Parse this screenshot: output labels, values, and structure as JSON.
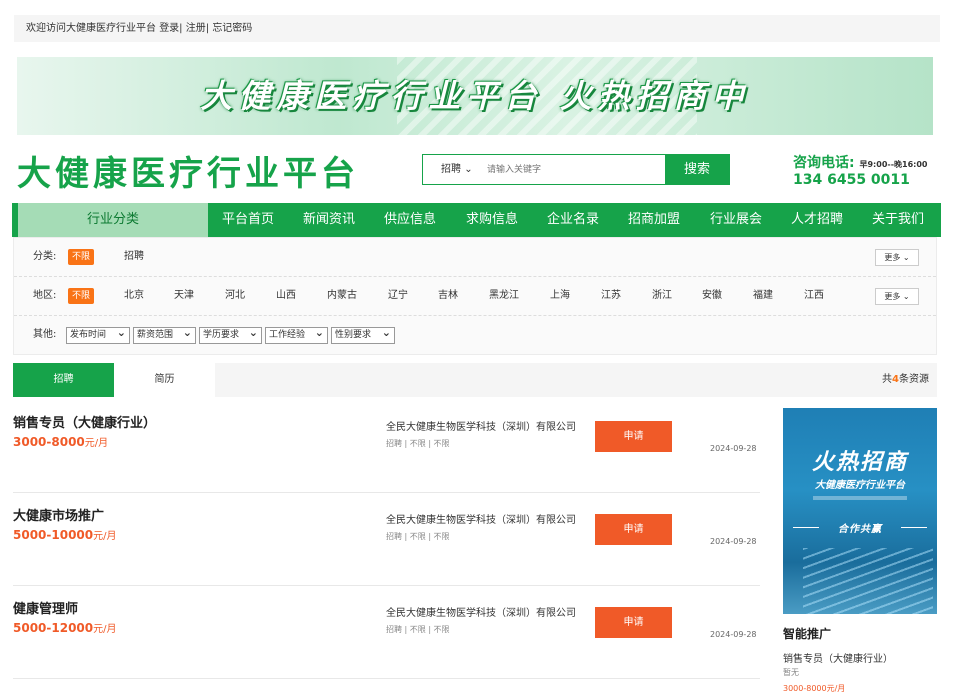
{
  "topbar": {
    "welcome": "欢迎访问大健康医疗行业平台",
    "login": "登录|",
    "register": "注册|",
    "forgot": "忘记密码"
  },
  "banner": {
    "text": "大健康医疗行业平台  火热招商中"
  },
  "logo": {
    "text": "大健康医疗行业平台"
  },
  "search": {
    "category": "招聘",
    "placeholder": "请输入关键字",
    "button": "搜索"
  },
  "contact": {
    "label": "咨询电话:",
    "hours": "早9:00--晚16:00",
    "phone": "134 6455 0011"
  },
  "nav": {
    "category": "行业分类",
    "items": [
      "平台首页",
      "新闻资讯",
      "供应信息",
      "求购信息",
      "企业名录",
      "招商加盟",
      "行业展会",
      "人才招聘",
      "关于我们"
    ]
  },
  "filters": {
    "type_label": "分类:",
    "type_selected": "不限",
    "type_options": [
      "招聘"
    ],
    "region_label": "地区:",
    "region_selected": "不限",
    "regions": [
      "北京",
      "天津",
      "河北",
      "山西",
      "内蒙古",
      "辽宁",
      "吉林",
      "黑龙江",
      "上海",
      "江苏",
      "浙江",
      "安徽",
      "福建",
      "江西"
    ],
    "more": "更多",
    "other_label": "其他:",
    "selects": [
      "发布时间",
      "薪资范围",
      "学历要求",
      "工作经验",
      "性别要求"
    ]
  },
  "tabs": {
    "active": "招聘",
    "inactive": "简历",
    "count_prefix": "共",
    "count": "4",
    "count_suffix": "条资源"
  },
  "jobs": [
    {
      "title": "销售专员（大健康行业）",
      "salary": "3000-8000",
      "unit": "元/月",
      "company": "全民大健康生物医学科技（深圳）有限公司",
      "meta": "招聘 | 不限 | 不限",
      "apply": "申请",
      "date": "2024-09-28"
    },
    {
      "title": "大健康市场推广",
      "salary": "5000-10000",
      "unit": "元/月",
      "company": "全民大健康生物医学科技（深圳）有限公司",
      "meta": "招聘 | 不限 | 不限",
      "apply": "申请",
      "date": "2024-09-28"
    },
    {
      "title": "健康管理师",
      "salary": "5000-12000",
      "unit": "元/月",
      "company": "全民大健康生物医学科技（深圳）有限公司",
      "meta": "招聘 | 不限 | 不限",
      "apply": "申请",
      "date": "2024-09-28"
    }
  ],
  "ad": {
    "headline": "火热招商",
    "sub": "大健康医疗行业平台",
    "tagline": "合作共赢",
    "dots": "• • • • •"
  },
  "promo": {
    "title": "智能推广",
    "job": "销售专员（大健康行业）",
    "note": "暂无",
    "salary": "3000-8000元/月"
  }
}
